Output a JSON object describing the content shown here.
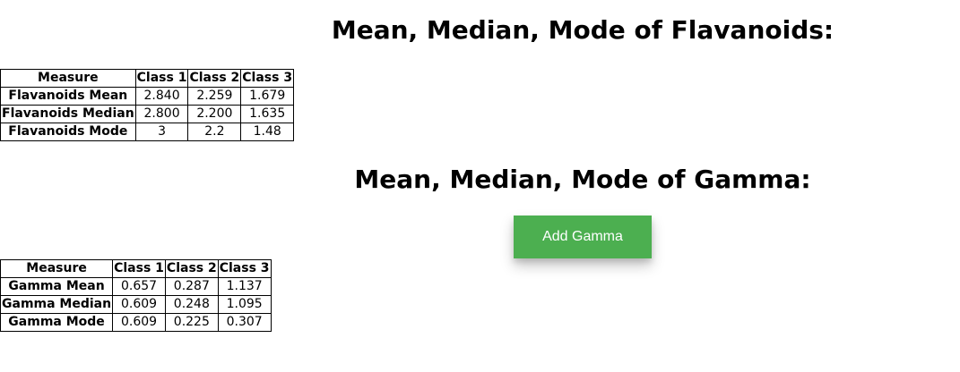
{
  "flavanoids": {
    "heading": "Mean, Median, Mode of Flavanoids:",
    "headers": [
      "Measure",
      "Class 1",
      "Class 2",
      "Class 3"
    ],
    "rows": [
      {
        "label": "Flavanoids Mean",
        "values": [
          "2.840",
          "2.259",
          "1.679"
        ]
      },
      {
        "label": "Flavanoids Median",
        "values": [
          "2.800",
          "2.200",
          "1.635"
        ]
      },
      {
        "label": "Flavanoids Mode",
        "values": [
          "3",
          "2.2",
          "1.48"
        ]
      }
    ]
  },
  "gamma": {
    "heading": "Mean, Median, Mode of Gamma:",
    "button_label": "Add Gamma",
    "button_color": "#4caf50",
    "headers": [
      "Measure",
      "Class 1",
      "Class 2",
      "Class 3"
    ],
    "rows": [
      {
        "label": "Gamma Mean",
        "values": [
          "0.657",
          "0.287",
          "1.137"
        ]
      },
      {
        "label": "Gamma Median",
        "values": [
          "0.609",
          "0.248",
          "1.095"
        ]
      },
      {
        "label": "Gamma Mode",
        "values": [
          "0.609",
          "0.225",
          "0.307"
        ]
      }
    ]
  }
}
